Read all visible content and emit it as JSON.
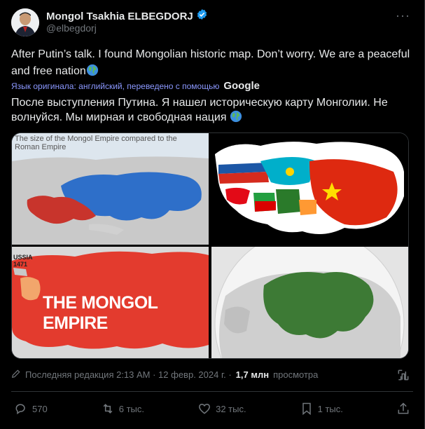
{
  "author": {
    "name": "Mongol Tsakhia ELBEGDORJ",
    "handle": "@elbegdorj",
    "verified_color": "#1d9bf0"
  },
  "post": {
    "text_en": "After Putin’s talk. I found Mongolian historic map. Don’t worry. We are a peaceful and free nation",
    "translation_note": "Язык оригинала: английский, переведено с помощью",
    "translation_brand": "Google",
    "text_ru": "После выступления Путина. Я нашел историческую карту Монголии. Не волнуйся. Мы мирная и свободная нация",
    "emoji": "globe-emoji"
  },
  "media": {
    "map1_caption": "The size of the Mongol Empire compared to the Roman Empire",
    "map3_title": "THE MONGOL EMPIRE",
    "map3_label_line1": "USSIA",
    "map3_label_line2": "1471"
  },
  "meta": {
    "edited_label": "Последняя редакция 2:13 AM · 12 февр. 2024 г. ·",
    "views_count": "1,7 млн",
    "views_label": "просмотра"
  },
  "actions": {
    "replies": "570",
    "reposts": "6 тыс.",
    "likes": "32 тыс.",
    "bookmarks": "1 тыс."
  },
  "colors": {
    "background": "#000000",
    "text": "#e7e9ea",
    "muted": "#71767b",
    "translate_link": "#8b98ff",
    "empire_red": "#e33b2e",
    "empire_blue": "#2e6fc9",
    "empire_green": "#3d7a35"
  }
}
